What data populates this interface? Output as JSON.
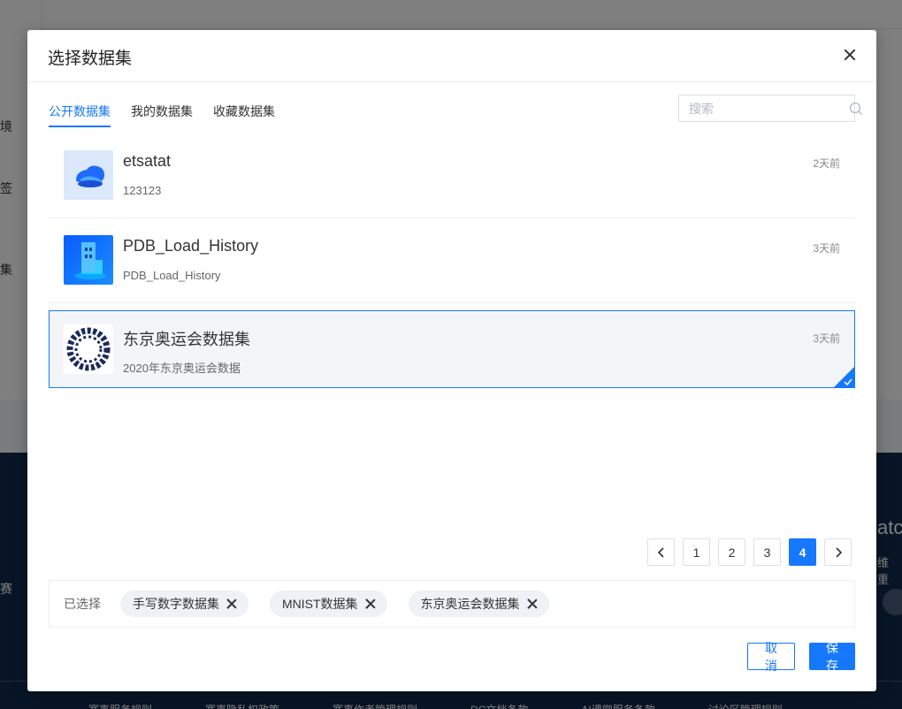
{
  "background": {
    "side_labels": [
      "境",
      "签",
      "集"
    ],
    "footer_left": "赛",
    "footer_brand": "atc",
    "footer_sub": "维 重",
    "footer_links": [
      "赛事服务规则",
      "赛事隐私权政策",
      "赛事作者管理规则",
      "DC文档条款",
      "AI课堂服务条款",
      "讨论区管理规则"
    ]
  },
  "modal": {
    "title": "选择数据集",
    "close_icon": "close-icon"
  },
  "tabs": [
    {
      "label": "公开数据集",
      "active": true
    },
    {
      "label": "我的数据集",
      "active": false
    },
    {
      "label": "收藏数据集",
      "active": false
    }
  ],
  "search": {
    "placeholder": "搜索",
    "value": "",
    "icon": "search-icon"
  },
  "datasets": [
    {
      "title": "etsatat",
      "subtitle": "123123",
      "time": "2天前",
      "selected": false,
      "thumb": "cloud-icon"
    },
    {
      "title": "PDB_Load_History",
      "subtitle": "PDB_Load_History",
      "time": "3天前",
      "selected": false,
      "thumb": "building-icon"
    },
    {
      "title": "东京奥运会数据集",
      "subtitle": "2020年东京奥运会数据",
      "time": "3天前",
      "selected": true,
      "thumb": "olympic-ring-icon"
    }
  ],
  "pagination": {
    "pages": [
      "1",
      "2",
      "3",
      "4"
    ],
    "current": "4"
  },
  "selection": {
    "label": "已选择",
    "chips": [
      "手写数字数据集",
      "MNIST数据集",
      "东京奥运会数据集"
    ]
  },
  "buttons": {
    "cancel": "取消",
    "save": "保存"
  },
  "colors": {
    "primary": "#1677ff",
    "footer_bg": "#0f2a4e",
    "selected_bg": "#f2f6f9"
  }
}
